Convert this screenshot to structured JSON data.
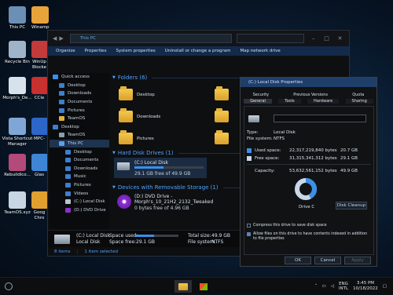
{
  "desktop": {
    "icons": [
      {
        "label": "This PC",
        "icon": "this-pc-icon"
      },
      {
        "label": "Winamp",
        "icon": "winamp-icon"
      },
      {
        "label": "Recycle Bin",
        "icon": "recycle-bin-icon"
      },
      {
        "label": "WinUp Blocke",
        "icon": "winupdate-blocker-icon"
      },
      {
        "label": "Morph's_De...",
        "icon": "document-icon"
      },
      {
        "label": "CCle",
        "icon": "ccleaner-icon"
      },
      {
        "label": "Vista Shortcut Manager",
        "icon": "shortcut-manager-icon"
      },
      {
        "label": "MPC-",
        "icon": "mpc-icon"
      },
      {
        "label": "Rebuildlco...",
        "icon": "rebuild-icon"
      },
      {
        "label": "Glas",
        "icon": "glass-icon"
      },
      {
        "label": "TeamOS.xyz",
        "icon": "teamos-file-icon"
      },
      {
        "label": "Goog Chro",
        "icon": "chrome-icon"
      }
    ]
  },
  "explorer": {
    "address": "This PC",
    "toolbar": [
      "Organize",
      "Properties",
      "System properties",
      "Uninstall or change a program",
      "Map network drive"
    ],
    "nav": [
      {
        "label": "Quick access",
        "icon": "star-icon",
        "indent": 0,
        "selected": false
      },
      {
        "label": "Desktop",
        "icon": "desktop-icon",
        "indent": 1,
        "selected": false
      },
      {
        "label": "Downloads",
        "icon": "downloads-icon",
        "indent": 1,
        "selected": false
      },
      {
        "label": "Documents",
        "icon": "documents-icon",
        "indent": 1,
        "selected": false
      },
      {
        "label": "Pictures",
        "icon": "pictures-icon",
        "indent": 1,
        "selected": false
      },
      {
        "label": "TeamOS",
        "icon": "folder-icon",
        "indent": 1,
        "selected": false
      },
      {
        "label": "Desktop",
        "icon": "desktop-icon",
        "indent": 0,
        "selected": false
      },
      {
        "label": "TeamOS",
        "icon": "user-icon",
        "indent": 1,
        "selected": false
      },
      {
        "label": "This PC",
        "icon": "pc-icon",
        "indent": 1,
        "selected": true
      },
      {
        "label": "Desktop",
        "icon": "desktop-icon",
        "indent": 2,
        "selected": false
      },
      {
        "label": "Documents",
        "icon": "documents-icon",
        "indent": 2,
        "selected": false
      },
      {
        "label": "Downloads",
        "icon": "downloads-icon",
        "indent": 2,
        "selected": false
      },
      {
        "label": "Music",
        "icon": "music-icon",
        "indent": 2,
        "selected": false
      },
      {
        "label": "Pictures",
        "icon": "pictures-icon",
        "indent": 2,
        "selected": false
      },
      {
        "label": "Videos",
        "icon": "videos-icon",
        "indent": 2,
        "selected": false
      },
      {
        "label": "(C:) Local Disk",
        "icon": "drive-icon",
        "indent": 2,
        "selected": false
      },
      {
        "label": "(D:) DVD Drive",
        "icon": "dvd-icon",
        "indent": 2,
        "selected": false
      }
    ],
    "groups": {
      "folders": "Folders (6)",
      "hdd": "Hard Disk Drives (1)",
      "removable": "Devices with Removable Storage (1)"
    },
    "folders": [
      "Desktop",
      "",
      "Downloads",
      "",
      "Pictures",
      ""
    ],
    "drive_c": {
      "name": "(C:) Local Disk",
      "free": "29.1 GB free of 49.9 GB",
      "used_fraction": 0.42
    },
    "drive_d": {
      "name": "(D:) DVD Drive -",
      "label": "Morph's_10_21H2_2132_Tweaked",
      "free": "0 bytes free of 4.96 GB"
    },
    "details": {
      "name": "(C:) Local Disk",
      "space_used_label": "Space used:",
      "space_free_label": "Space free:",
      "space_free": "29.1 GB",
      "total_size_label": "Total size:",
      "total_size": "49.9 GB",
      "fs_label": "File system:",
      "fs": "NTFS",
      "sub": "Local Disk"
    },
    "status": {
      "items": "8 items",
      "selected": "1 item selected"
    }
  },
  "props": {
    "title": "(C:) Local Disk Properties",
    "tabs_row1": [
      "Security",
      "Previous Versions",
      "Quota"
    ],
    "tabs_row2": [
      "General",
      "Tools",
      "Hardware",
      "Sharing"
    ],
    "type_label": "Type:",
    "type": "Local Disk",
    "fs_label": "File system:",
    "fs": "NTFS",
    "used_label": "Used space:",
    "used_bytes": "22,317,219,840 bytes",
    "used_gb": "20.7 GB",
    "free_label": "Free space:",
    "free_bytes": "31,315,341,312 bytes",
    "free_gb": "29.1 GB",
    "cap_label": "Capacity:",
    "cap_bytes": "53,632,561,152 bytes",
    "cap_gb": "49.9 GB",
    "used_fraction": 0.42,
    "drive_label": "Drive C",
    "cleanup": "Disk Cleanup",
    "compress": "Compress this drive to save disk space",
    "index": "Allow files on this drive to have contents indexed in addition to file properties",
    "ok": "OK",
    "cancel": "Cancel",
    "apply": "Apply",
    "used_color": "#3b8fe8",
    "free_color": "#c9d8e8"
  },
  "taskbar": {
    "lang": "ENG",
    "layout": "INTL",
    "time": "3:45 PM",
    "date": "10/18/2022"
  }
}
